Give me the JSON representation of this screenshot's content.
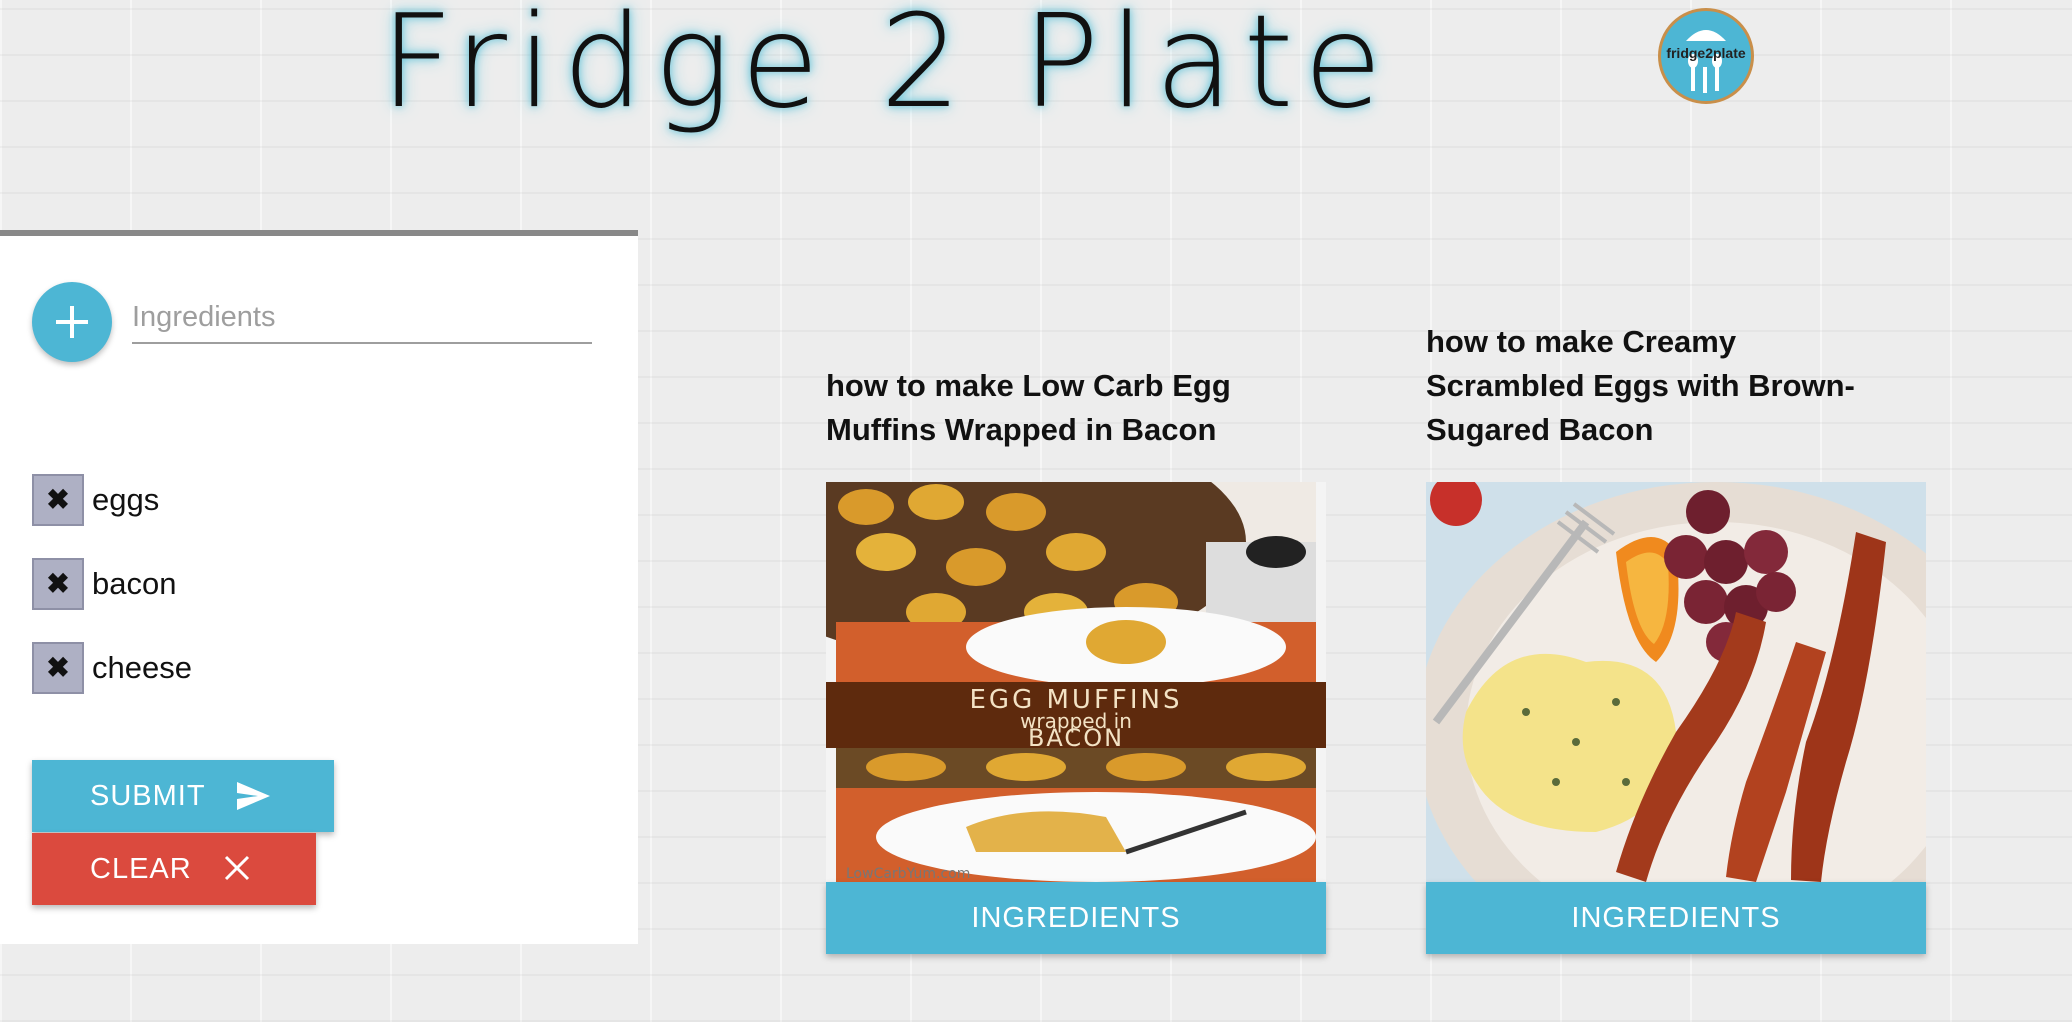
{
  "header": {
    "title": "Fridge 2 Plate",
    "logo_text": "fridge2plate"
  },
  "sidebar": {
    "add_icon": "plus-icon",
    "input_placeholder": "Ingredients",
    "input_value": "",
    "ingredients": [
      {
        "label": "eggs",
        "remove_icon": "close-x-icon"
      },
      {
        "label": "bacon",
        "remove_icon": "close-x-icon"
      },
      {
        "label": "cheese",
        "remove_icon": "close-x-icon"
      }
    ],
    "submit_label": "SUBMIT",
    "submit_icon": "send-icon",
    "clear_label": "CLEAR",
    "clear_icon": "close-icon"
  },
  "recipes": [
    {
      "title": "how to make Low Carb Egg Muffins Wrapped in Bacon",
      "image_text_1": "EGG MUFFINS",
      "image_text_2": "wrapped in",
      "image_text_3": "BACON",
      "watermark": "LowCarbYum.com",
      "button_label": "INGREDIENTS"
    },
    {
      "title": "how to make Creamy Scrambled Eggs with Brown-Sugared Bacon",
      "button_label": "INGREDIENTS"
    }
  ],
  "colors": {
    "accent": "#4db6d4",
    "danger": "#db4a3e",
    "chip": "#aeb0c4"
  }
}
